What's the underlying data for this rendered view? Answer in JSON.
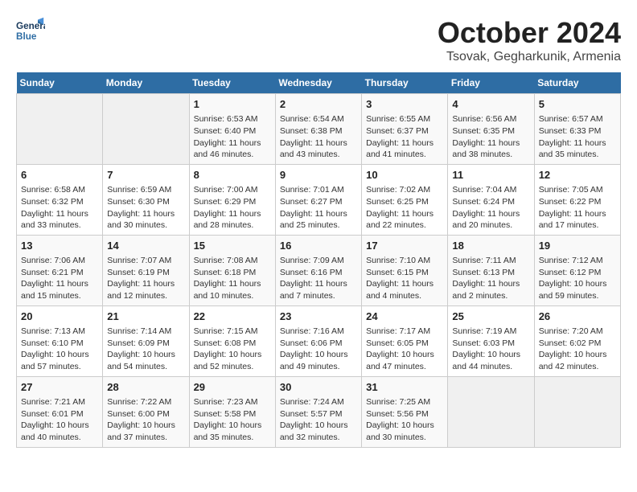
{
  "header": {
    "logo_line1": "General",
    "logo_line2": "Blue",
    "month": "October 2024",
    "location": "Tsovak, Gegharkunik, Armenia"
  },
  "weekdays": [
    "Sunday",
    "Monday",
    "Tuesday",
    "Wednesday",
    "Thursday",
    "Friday",
    "Saturday"
  ],
  "weeks": [
    [
      {
        "day": null
      },
      {
        "day": null
      },
      {
        "day": "1",
        "sunrise": "6:53 AM",
        "sunset": "6:40 PM",
        "daylight": "11 hours and 46 minutes."
      },
      {
        "day": "2",
        "sunrise": "6:54 AM",
        "sunset": "6:38 PM",
        "daylight": "11 hours and 43 minutes."
      },
      {
        "day": "3",
        "sunrise": "6:55 AM",
        "sunset": "6:37 PM",
        "daylight": "11 hours and 41 minutes."
      },
      {
        "day": "4",
        "sunrise": "6:56 AM",
        "sunset": "6:35 PM",
        "daylight": "11 hours and 38 minutes."
      },
      {
        "day": "5",
        "sunrise": "6:57 AM",
        "sunset": "6:33 PM",
        "daylight": "11 hours and 35 minutes."
      }
    ],
    [
      {
        "day": "6",
        "sunrise": "6:58 AM",
        "sunset": "6:32 PM",
        "daylight": "11 hours and 33 minutes."
      },
      {
        "day": "7",
        "sunrise": "6:59 AM",
        "sunset": "6:30 PM",
        "daylight": "11 hours and 30 minutes."
      },
      {
        "day": "8",
        "sunrise": "7:00 AM",
        "sunset": "6:29 PM",
        "daylight": "11 hours and 28 minutes."
      },
      {
        "day": "9",
        "sunrise": "7:01 AM",
        "sunset": "6:27 PM",
        "daylight": "11 hours and 25 minutes."
      },
      {
        "day": "10",
        "sunrise": "7:02 AM",
        "sunset": "6:25 PM",
        "daylight": "11 hours and 22 minutes."
      },
      {
        "day": "11",
        "sunrise": "7:04 AM",
        "sunset": "6:24 PM",
        "daylight": "11 hours and 20 minutes."
      },
      {
        "day": "12",
        "sunrise": "7:05 AM",
        "sunset": "6:22 PM",
        "daylight": "11 hours and 17 minutes."
      }
    ],
    [
      {
        "day": "13",
        "sunrise": "7:06 AM",
        "sunset": "6:21 PM",
        "daylight": "11 hours and 15 minutes."
      },
      {
        "day": "14",
        "sunrise": "7:07 AM",
        "sunset": "6:19 PM",
        "daylight": "11 hours and 12 minutes."
      },
      {
        "day": "15",
        "sunrise": "7:08 AM",
        "sunset": "6:18 PM",
        "daylight": "11 hours and 10 minutes."
      },
      {
        "day": "16",
        "sunrise": "7:09 AM",
        "sunset": "6:16 PM",
        "daylight": "11 hours and 7 minutes."
      },
      {
        "day": "17",
        "sunrise": "7:10 AM",
        "sunset": "6:15 PM",
        "daylight": "11 hours and 4 minutes."
      },
      {
        "day": "18",
        "sunrise": "7:11 AM",
        "sunset": "6:13 PM",
        "daylight": "11 hours and 2 minutes."
      },
      {
        "day": "19",
        "sunrise": "7:12 AM",
        "sunset": "6:12 PM",
        "daylight": "10 hours and 59 minutes."
      }
    ],
    [
      {
        "day": "20",
        "sunrise": "7:13 AM",
        "sunset": "6:10 PM",
        "daylight": "10 hours and 57 minutes."
      },
      {
        "day": "21",
        "sunrise": "7:14 AM",
        "sunset": "6:09 PM",
        "daylight": "10 hours and 54 minutes."
      },
      {
        "day": "22",
        "sunrise": "7:15 AM",
        "sunset": "6:08 PM",
        "daylight": "10 hours and 52 minutes."
      },
      {
        "day": "23",
        "sunrise": "7:16 AM",
        "sunset": "6:06 PM",
        "daylight": "10 hours and 49 minutes."
      },
      {
        "day": "24",
        "sunrise": "7:17 AM",
        "sunset": "6:05 PM",
        "daylight": "10 hours and 47 minutes."
      },
      {
        "day": "25",
        "sunrise": "7:19 AM",
        "sunset": "6:03 PM",
        "daylight": "10 hours and 44 minutes."
      },
      {
        "day": "26",
        "sunrise": "7:20 AM",
        "sunset": "6:02 PM",
        "daylight": "10 hours and 42 minutes."
      }
    ],
    [
      {
        "day": "27",
        "sunrise": "7:21 AM",
        "sunset": "6:01 PM",
        "daylight": "10 hours and 40 minutes."
      },
      {
        "day": "28",
        "sunrise": "7:22 AM",
        "sunset": "6:00 PM",
        "daylight": "10 hours and 37 minutes."
      },
      {
        "day": "29",
        "sunrise": "7:23 AM",
        "sunset": "5:58 PM",
        "daylight": "10 hours and 35 minutes."
      },
      {
        "day": "30",
        "sunrise": "7:24 AM",
        "sunset": "5:57 PM",
        "daylight": "10 hours and 32 minutes."
      },
      {
        "day": "31",
        "sunrise": "7:25 AM",
        "sunset": "5:56 PM",
        "daylight": "10 hours and 30 minutes."
      },
      {
        "day": null
      },
      {
        "day": null
      }
    ]
  ]
}
